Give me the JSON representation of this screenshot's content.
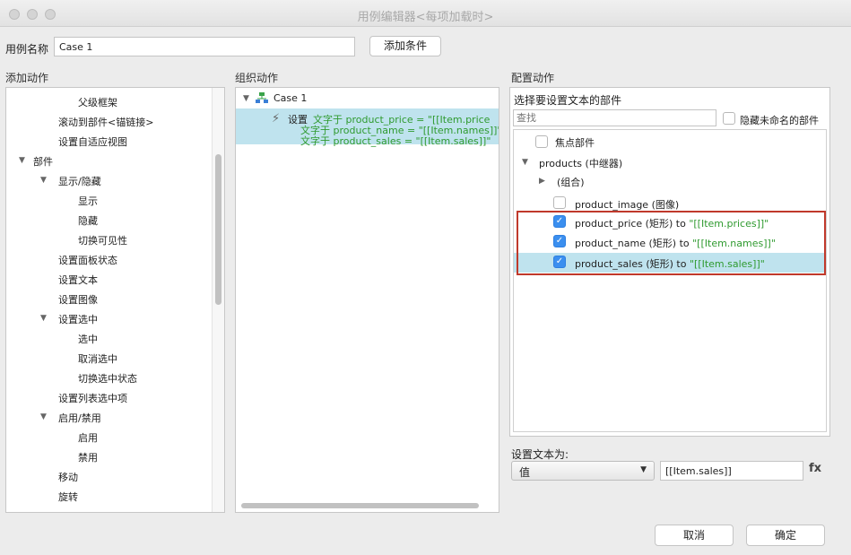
{
  "window": {
    "title": "用例编辑器<每项加载时>"
  },
  "case_name": {
    "label": "用例名称",
    "value": "Case 1",
    "add_condition": "添加条件"
  },
  "add_action": {
    "title": "添加动作",
    "items": [
      {
        "label": "父级框架",
        "arrow": ""
      },
      {
        "label": "滚动到部件<锚链接>",
        "arrow": ""
      },
      {
        "label": "设置自适应视图",
        "arrow": ""
      },
      {
        "label": "部件",
        "arrow": "▼"
      },
      {
        "label": "显示/隐藏",
        "arrow": "▼"
      },
      {
        "label": "显示",
        "arrow": ""
      },
      {
        "label": "隐藏",
        "arrow": ""
      },
      {
        "label": "切换可见性",
        "arrow": ""
      },
      {
        "label": "设置面板状态",
        "arrow": ""
      },
      {
        "label": "设置文本",
        "arrow": ""
      },
      {
        "label": "设置图像",
        "arrow": ""
      },
      {
        "label": "设置选中",
        "arrow": "▼"
      },
      {
        "label": "选中",
        "arrow": ""
      },
      {
        "label": "取消选中",
        "arrow": ""
      },
      {
        "label": "切换选中状态",
        "arrow": ""
      },
      {
        "label": "设置列表选中项",
        "arrow": ""
      },
      {
        "label": "启用/禁用",
        "arrow": "▼"
      },
      {
        "label": "启用",
        "arrow": ""
      },
      {
        "label": "禁用",
        "arrow": ""
      },
      {
        "label": "移动",
        "arrow": ""
      },
      {
        "label": "旋转",
        "arrow": ""
      }
    ]
  },
  "organize": {
    "title": "组织动作",
    "case_label": "Case 1",
    "action_verb": "设置",
    "lines": [
      "文字于 product_price = \"[[Item.price",
      "文字于 product_name = \"[[Item.names]]\"",
      "文字于 product_sales = \"[[Item.sales]]\""
    ]
  },
  "configure": {
    "title": "配置动作",
    "subtitle": "选择要设置文本的部件",
    "search_placeholder": "查找",
    "hide_unnamed": "隐藏未命名的部件",
    "widgets": [
      {
        "label": "焦点部件",
        "green": "",
        "checked": false,
        "arrow": ""
      },
      {
        "label": "products (中继器)",
        "green": "",
        "checked": null,
        "arrow": "▼"
      },
      {
        "label": "(组合)",
        "green": "",
        "checked": null,
        "arrow": "▶"
      },
      {
        "label": "product_image (图像)",
        "green": "",
        "checked": false,
        "arrow": ""
      },
      {
        "label": "product_price (矩形) to ",
        "green": "\"[[Item.prices]]\"",
        "checked": true,
        "arrow": ""
      },
      {
        "label": "product_name (矩形) to ",
        "green": "\"[[Item.names]]\"",
        "checked": true,
        "arrow": ""
      },
      {
        "label": "product_sales (矩形) to ",
        "green": "\"[[Item.sales]]\"",
        "checked": true,
        "arrow": ""
      }
    ],
    "set_text_label": "设置文本为:",
    "value_type": "值",
    "value": "[[Item.sales]]",
    "fx": "fx"
  },
  "footer": {
    "cancel": "取消",
    "ok": "确定"
  },
  "colors": {
    "highlight": "#bfe3ee",
    "accent_red": "#c0392b",
    "check_blue": "#3b8fef",
    "green_text": "#2f9a2f"
  }
}
